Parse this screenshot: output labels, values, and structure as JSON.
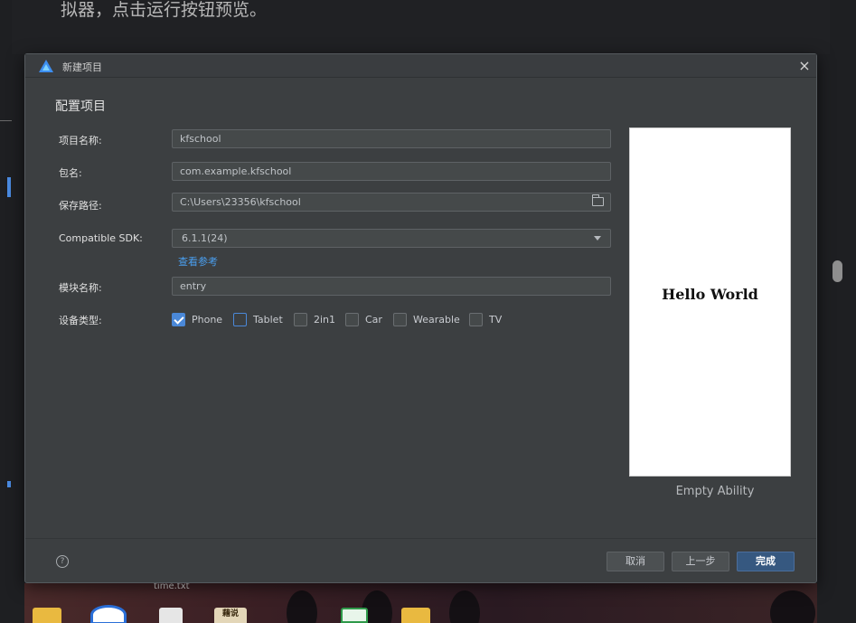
{
  "background": {
    "doc_text": "拟器，点击运行按钮预览。",
    "desktop_file_label": "time.txt",
    "seal_text": "藉说"
  },
  "dialog": {
    "title": "新建项目",
    "close_glyph": "×",
    "heading": "配置项目",
    "fields": {
      "project_name": {
        "label": "项目名称:",
        "value": "kfschool"
      },
      "package_name": {
        "label": "包名:",
        "value": "com.example.kfschool"
      },
      "save_path": {
        "label": "保存路径:",
        "value": "C:\\Users\\23356\\kfschool"
      },
      "sdk": {
        "label": "Compatible SDK:",
        "value": "6.1.1(24)"
      },
      "module_name": {
        "label": "模块名称:",
        "value": "entry"
      },
      "device_type": {
        "label": "设备类型:"
      }
    },
    "sdk_link": "查看参考",
    "devices": [
      {
        "label": "Phone",
        "checked": true
      },
      {
        "label": "Tablet",
        "checked": false
      },
      {
        "label": "2in1",
        "checked": false
      },
      {
        "label": "Car",
        "checked": false
      },
      {
        "label": "Wearable",
        "checked": false
      },
      {
        "label": "TV",
        "checked": false
      }
    ],
    "preview": {
      "text": "Hello World",
      "caption": "Empty Ability"
    },
    "footer": {
      "help_glyph": "?",
      "cancel": "取消",
      "previous": "上一步",
      "finish": "完成"
    }
  },
  "colors": {
    "dialog_bg": "#3c3f41",
    "accent": "#4a88d8",
    "primary_button": "#365880",
    "link": "#4a9ff0"
  }
}
